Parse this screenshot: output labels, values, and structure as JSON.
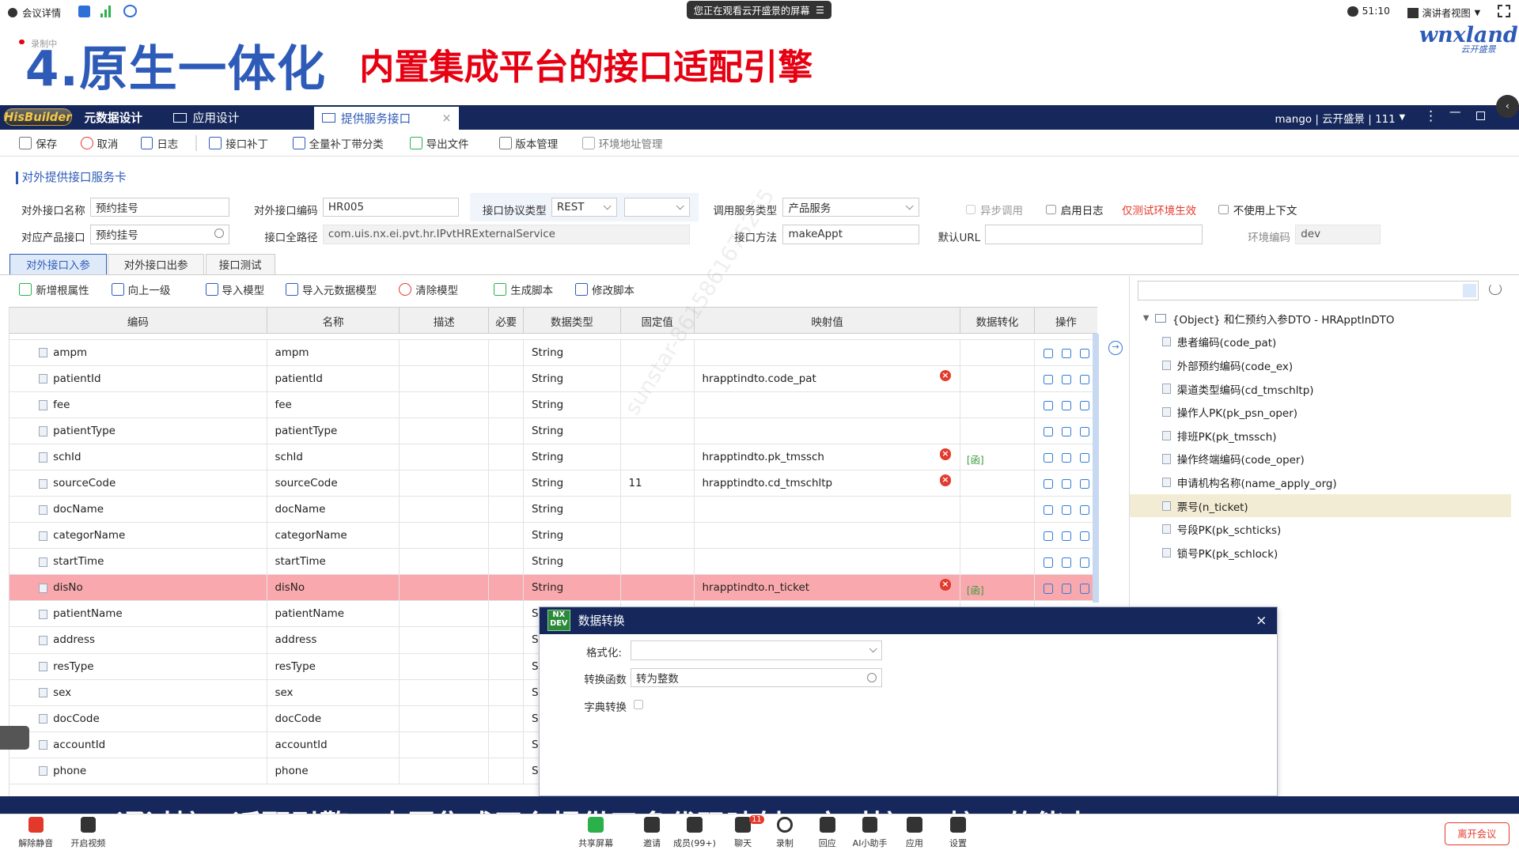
{
  "meeting": {
    "info_label": "会议详情",
    "share_notice": "您正在观看云开盛景的屏幕",
    "timer": "51:10",
    "view_label": "演讲者视图",
    "leave_label": "离开会议",
    "buttons": [
      "解除静音",
      "开启视频",
      "共享屏幕",
      "邀请",
      "成员(99+)",
      "聊天",
      "录制",
      "回应",
      "AI小助手",
      "应用",
      "设置"
    ],
    "chat_badge": "11"
  },
  "slide": {
    "rec_label": "录制中",
    "title": "4.原生一体化",
    "subtitle": "内置集成平台的接口适配引擎",
    "logo": "wnxland",
    "logo_sub": "云开盛景",
    "caption": "通过接口适配引擎，内置集成平台提供了多代码映射，方对接his接口的能力"
  },
  "app": {
    "logo": "HisBuilder",
    "tabs": [
      "元数据设计",
      "应用设计",
      "提供服务接口"
    ],
    "user": "mango | 云开盛景 | 111"
  },
  "toolbar": [
    "保存",
    "取消",
    "日志",
    "接口补丁",
    "全量补丁带分类",
    "导出文件",
    "版本管理",
    "环境地址管理"
  ],
  "form": {
    "card_title": "对外提供接口服务卡",
    "fields": {
      "name_label": "对外接口名称",
      "name": "预约挂号",
      "code_label": "对外接口编码",
      "code": "HR005",
      "protocol_label": "接口协议类型",
      "protocol": "REST",
      "service_type_label": "调用服务类型",
      "service_type": "产品服务",
      "async_label": "异步调用",
      "log_label": "启用日志",
      "debug_env_label": "仅测试环境生效",
      "no_ctx_label": "不使用上下文",
      "product_label": "对应产品接口",
      "product": "预约挂号",
      "path_label": "接口全路径",
      "path": "com.uis.nx.ei.pvt.hr.IPvtHRExternalService",
      "method_label": "接口方法",
      "method": "makeAppt",
      "url_label": "默认URL",
      "url": "",
      "env_label": "环境编码",
      "env": "dev"
    }
  },
  "subtabs": [
    "对外接口入参",
    "对外接口出参",
    "接口测试"
  ],
  "table_toolbar": [
    "新增根属性",
    "向上一级",
    "导入模型",
    "导入元数据模型",
    "清除模型",
    "生成脚本",
    "修改脚本"
  ],
  "grid": {
    "headers": [
      "编码",
      "名称",
      "描述",
      "必要",
      "数据类型",
      "固定值",
      "映射值",
      "数据转化",
      "操作"
    ],
    "rows": [
      {
        "code": "ampm",
        "name": "ampm",
        "type": "String",
        "fixed": "",
        "map": "",
        "fn": "",
        "sel": false
      },
      {
        "code": "patientId",
        "name": "patientId",
        "type": "String",
        "fixed": "",
        "map": "hrapptindto.code_pat",
        "fn": "",
        "sel": false
      },
      {
        "code": "fee",
        "name": "fee",
        "type": "String",
        "fixed": "",
        "map": "",
        "fn": "",
        "sel": false
      },
      {
        "code": "patientType",
        "name": "patientType",
        "type": "String",
        "fixed": "",
        "map": "",
        "fn": "",
        "sel": false
      },
      {
        "code": "schId",
        "name": "schId",
        "type": "String",
        "fixed": "",
        "map": "hrapptindto.pk_tmssch",
        "fn": "[函]",
        "sel": false
      },
      {
        "code": "sourceCode",
        "name": "sourceCode",
        "type": "String",
        "fixed": "11",
        "map": "hrapptindto.cd_tmschltp",
        "fn": "",
        "sel": false
      },
      {
        "code": "docName",
        "name": "docName",
        "type": "String",
        "fixed": "",
        "map": "",
        "fn": "",
        "sel": false
      },
      {
        "code": "categorName",
        "name": "categorName",
        "type": "String",
        "fixed": "",
        "map": "",
        "fn": "",
        "sel": false
      },
      {
        "code": "startTime",
        "name": "startTime",
        "type": "String",
        "fixed": "",
        "map": "",
        "fn": "",
        "sel": false
      },
      {
        "code": "disNo",
        "name": "disNo",
        "type": "String",
        "fixed": "",
        "map": "hrapptindto.n_ticket",
        "fn": "[函]",
        "sel": true
      },
      {
        "code": "patientName",
        "name": "patientName",
        "type": "S",
        "fixed": "",
        "map": "",
        "fn": "",
        "sel": false
      },
      {
        "code": "address",
        "name": "address",
        "type": "S",
        "fixed": "",
        "map": "",
        "fn": "",
        "sel": false
      },
      {
        "code": "resType",
        "name": "resType",
        "type": "S",
        "fixed": "",
        "map": "",
        "fn": "",
        "sel": false
      },
      {
        "code": "sex",
        "name": "sex",
        "type": "S",
        "fixed": "",
        "map": "",
        "fn": "",
        "sel": false
      },
      {
        "code": "docCode",
        "name": "docCode",
        "type": "S",
        "fixed": "",
        "map": "",
        "fn": "",
        "sel": false
      },
      {
        "code": "accountId",
        "name": "accountId",
        "type": "S",
        "fixed": "",
        "map": "",
        "fn": "",
        "sel": false
      },
      {
        "code": "phone",
        "name": "phone",
        "type": "S",
        "fixed": "",
        "map": "",
        "fn": "",
        "sel": false
      }
    ]
  },
  "tree": {
    "root": "{Object} 和仁预约入参DTO - HRApptInDTO",
    "items": [
      "患者编码(code_pat)",
      "外部预约编码(code_ex)",
      "渠道类型编码(cd_tmschltp)",
      "操作人PK(pk_psn_oper)",
      "排班PK(pk_tmssch)",
      "操作终端编码(code_oper)",
      "申请机构名称(name_apply_org)",
      "票号(n_ticket)",
      "号段PK(pk_schticks)",
      "锁号PK(pk_schlock)"
    ],
    "highlighted_index": 7
  },
  "dialog": {
    "logo": "NX DEV",
    "title": "数据转换",
    "format_label": "格式化:",
    "format_value": "",
    "func_label": "转换函数",
    "func_value": "转为整数",
    "dict_label": "字典转换"
  },
  "watermark": "sunstar-8615861675265",
  "colors": {
    "brand": "#16285b",
    "accent": "#2e5bb8",
    "title_red": "#e60012",
    "selected_row": "#f9a9ad"
  }
}
